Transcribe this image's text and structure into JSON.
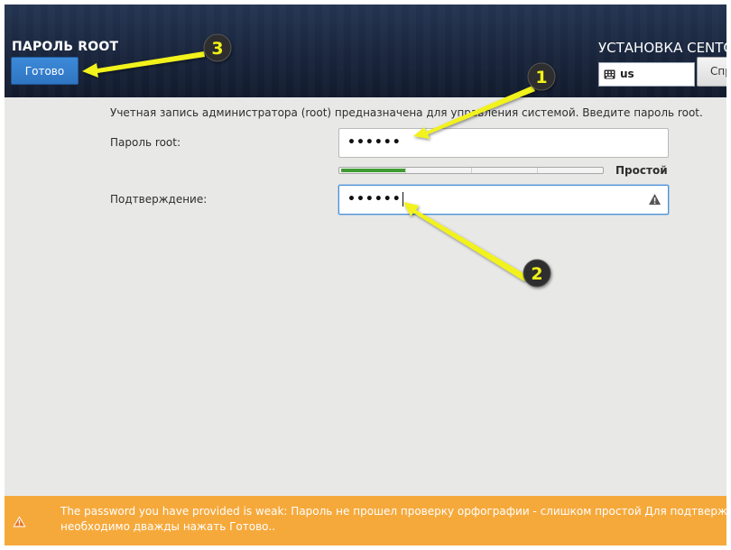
{
  "header": {
    "page_title": "ПАРОЛЬ ROOT",
    "done_label": "Готово",
    "installer_title": "УСТАНОВКА CENTO",
    "keyboard_layout": "us",
    "help_label": "Спр"
  },
  "form": {
    "description": "Учетная запись администратора (root) предназначена для управления системой. Введите пароль root.",
    "password_label": "Пароль root:",
    "password_value": "••••••",
    "confirm_label": "Подтверждение:",
    "confirm_value": "••••••",
    "strength_label": "Простой",
    "strength_level": 0.25
  },
  "notice": {
    "line1": "The password you have provided is weak: Пароль не прошел проверку орфографии - слишком простой Для подтверждени",
    "line2": "необходимо дважды нажать Готово.."
  },
  "annotations": {
    "marker1": "1",
    "marker2": "2",
    "marker3": "3"
  },
  "colors": {
    "header": "#1b2740",
    "done_button": "#3582d0",
    "strength_fill": "#3f9b32",
    "notice": "#f6a93b",
    "arrow": "#f2f21b"
  }
}
